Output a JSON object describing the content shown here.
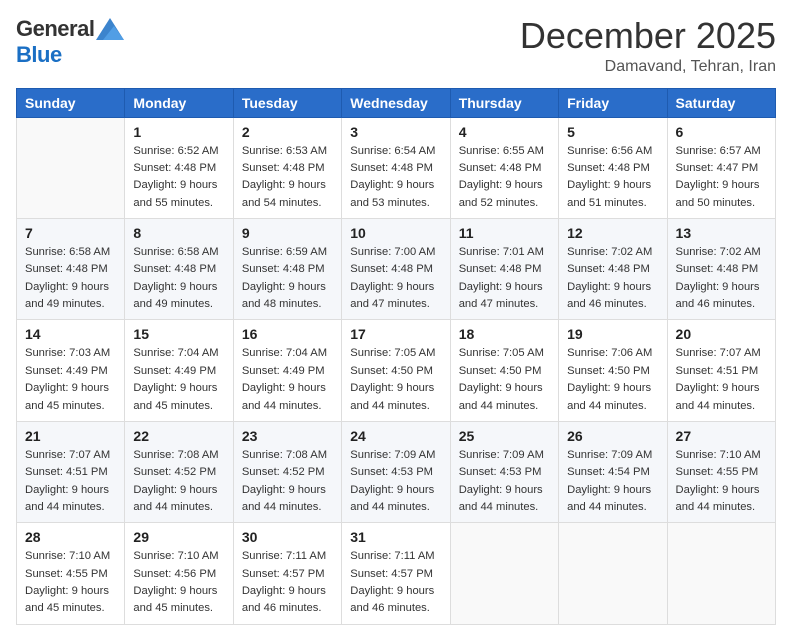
{
  "header": {
    "logo_general": "General",
    "logo_blue": "Blue",
    "month_title": "December 2025",
    "location": "Damavand, Tehran, Iran"
  },
  "calendar": {
    "days_of_week": [
      "Sunday",
      "Monday",
      "Tuesday",
      "Wednesday",
      "Thursday",
      "Friday",
      "Saturday"
    ],
    "weeks": [
      [
        {
          "day": "",
          "sunrise": "",
          "sunset": "",
          "daylight": ""
        },
        {
          "day": "1",
          "sunrise": "Sunrise: 6:52 AM",
          "sunset": "Sunset: 4:48 PM",
          "daylight": "Daylight: 9 hours and 55 minutes."
        },
        {
          "day": "2",
          "sunrise": "Sunrise: 6:53 AM",
          "sunset": "Sunset: 4:48 PM",
          "daylight": "Daylight: 9 hours and 54 minutes."
        },
        {
          "day": "3",
          "sunrise": "Sunrise: 6:54 AM",
          "sunset": "Sunset: 4:48 PM",
          "daylight": "Daylight: 9 hours and 53 minutes."
        },
        {
          "day": "4",
          "sunrise": "Sunrise: 6:55 AM",
          "sunset": "Sunset: 4:48 PM",
          "daylight": "Daylight: 9 hours and 52 minutes."
        },
        {
          "day": "5",
          "sunrise": "Sunrise: 6:56 AM",
          "sunset": "Sunset: 4:48 PM",
          "daylight": "Daylight: 9 hours and 51 minutes."
        },
        {
          "day": "6",
          "sunrise": "Sunrise: 6:57 AM",
          "sunset": "Sunset: 4:47 PM",
          "daylight": "Daylight: 9 hours and 50 minutes."
        }
      ],
      [
        {
          "day": "7",
          "sunrise": "Sunrise: 6:58 AM",
          "sunset": "Sunset: 4:48 PM",
          "daylight": "Daylight: 9 hours and 49 minutes."
        },
        {
          "day": "8",
          "sunrise": "Sunrise: 6:58 AM",
          "sunset": "Sunset: 4:48 PM",
          "daylight": "Daylight: 9 hours and 49 minutes."
        },
        {
          "day": "9",
          "sunrise": "Sunrise: 6:59 AM",
          "sunset": "Sunset: 4:48 PM",
          "daylight": "Daylight: 9 hours and 48 minutes."
        },
        {
          "day": "10",
          "sunrise": "Sunrise: 7:00 AM",
          "sunset": "Sunset: 4:48 PM",
          "daylight": "Daylight: 9 hours and 47 minutes."
        },
        {
          "day": "11",
          "sunrise": "Sunrise: 7:01 AM",
          "sunset": "Sunset: 4:48 PM",
          "daylight": "Daylight: 9 hours and 47 minutes."
        },
        {
          "day": "12",
          "sunrise": "Sunrise: 7:02 AM",
          "sunset": "Sunset: 4:48 PM",
          "daylight": "Daylight: 9 hours and 46 minutes."
        },
        {
          "day": "13",
          "sunrise": "Sunrise: 7:02 AM",
          "sunset": "Sunset: 4:48 PM",
          "daylight": "Daylight: 9 hours and 46 minutes."
        }
      ],
      [
        {
          "day": "14",
          "sunrise": "Sunrise: 7:03 AM",
          "sunset": "Sunset: 4:49 PM",
          "daylight": "Daylight: 9 hours and 45 minutes."
        },
        {
          "day": "15",
          "sunrise": "Sunrise: 7:04 AM",
          "sunset": "Sunset: 4:49 PM",
          "daylight": "Daylight: 9 hours and 45 minutes."
        },
        {
          "day": "16",
          "sunrise": "Sunrise: 7:04 AM",
          "sunset": "Sunset: 4:49 PM",
          "daylight": "Daylight: 9 hours and 44 minutes."
        },
        {
          "day": "17",
          "sunrise": "Sunrise: 7:05 AM",
          "sunset": "Sunset: 4:50 PM",
          "daylight": "Daylight: 9 hours and 44 minutes."
        },
        {
          "day": "18",
          "sunrise": "Sunrise: 7:05 AM",
          "sunset": "Sunset: 4:50 PM",
          "daylight": "Daylight: 9 hours and 44 minutes."
        },
        {
          "day": "19",
          "sunrise": "Sunrise: 7:06 AM",
          "sunset": "Sunset: 4:50 PM",
          "daylight": "Daylight: 9 hours and 44 minutes."
        },
        {
          "day": "20",
          "sunrise": "Sunrise: 7:07 AM",
          "sunset": "Sunset: 4:51 PM",
          "daylight": "Daylight: 9 hours and 44 minutes."
        }
      ],
      [
        {
          "day": "21",
          "sunrise": "Sunrise: 7:07 AM",
          "sunset": "Sunset: 4:51 PM",
          "daylight": "Daylight: 9 hours and 44 minutes."
        },
        {
          "day": "22",
          "sunrise": "Sunrise: 7:08 AM",
          "sunset": "Sunset: 4:52 PM",
          "daylight": "Daylight: 9 hours and 44 minutes."
        },
        {
          "day": "23",
          "sunrise": "Sunrise: 7:08 AM",
          "sunset": "Sunset: 4:52 PM",
          "daylight": "Daylight: 9 hours and 44 minutes."
        },
        {
          "day": "24",
          "sunrise": "Sunrise: 7:09 AM",
          "sunset": "Sunset: 4:53 PM",
          "daylight": "Daylight: 9 hours and 44 minutes."
        },
        {
          "day": "25",
          "sunrise": "Sunrise: 7:09 AM",
          "sunset": "Sunset: 4:53 PM",
          "daylight": "Daylight: 9 hours and 44 minutes."
        },
        {
          "day": "26",
          "sunrise": "Sunrise: 7:09 AM",
          "sunset": "Sunset: 4:54 PM",
          "daylight": "Daylight: 9 hours and 44 minutes."
        },
        {
          "day": "27",
          "sunrise": "Sunrise: 7:10 AM",
          "sunset": "Sunset: 4:55 PM",
          "daylight": "Daylight: 9 hours and 44 minutes."
        }
      ],
      [
        {
          "day": "28",
          "sunrise": "Sunrise: 7:10 AM",
          "sunset": "Sunset: 4:55 PM",
          "daylight": "Daylight: 9 hours and 45 minutes."
        },
        {
          "day": "29",
          "sunrise": "Sunrise: 7:10 AM",
          "sunset": "Sunset: 4:56 PM",
          "daylight": "Daylight: 9 hours and 45 minutes."
        },
        {
          "day": "30",
          "sunrise": "Sunrise: 7:11 AM",
          "sunset": "Sunset: 4:57 PM",
          "daylight": "Daylight: 9 hours and 46 minutes."
        },
        {
          "day": "31",
          "sunrise": "Sunrise: 7:11 AM",
          "sunset": "Sunset: 4:57 PM",
          "daylight": "Daylight: 9 hours and 46 minutes."
        },
        {
          "day": "",
          "sunrise": "",
          "sunset": "",
          "daylight": ""
        },
        {
          "day": "",
          "sunrise": "",
          "sunset": "",
          "daylight": ""
        },
        {
          "day": "",
          "sunrise": "",
          "sunset": "",
          "daylight": ""
        }
      ]
    ]
  }
}
